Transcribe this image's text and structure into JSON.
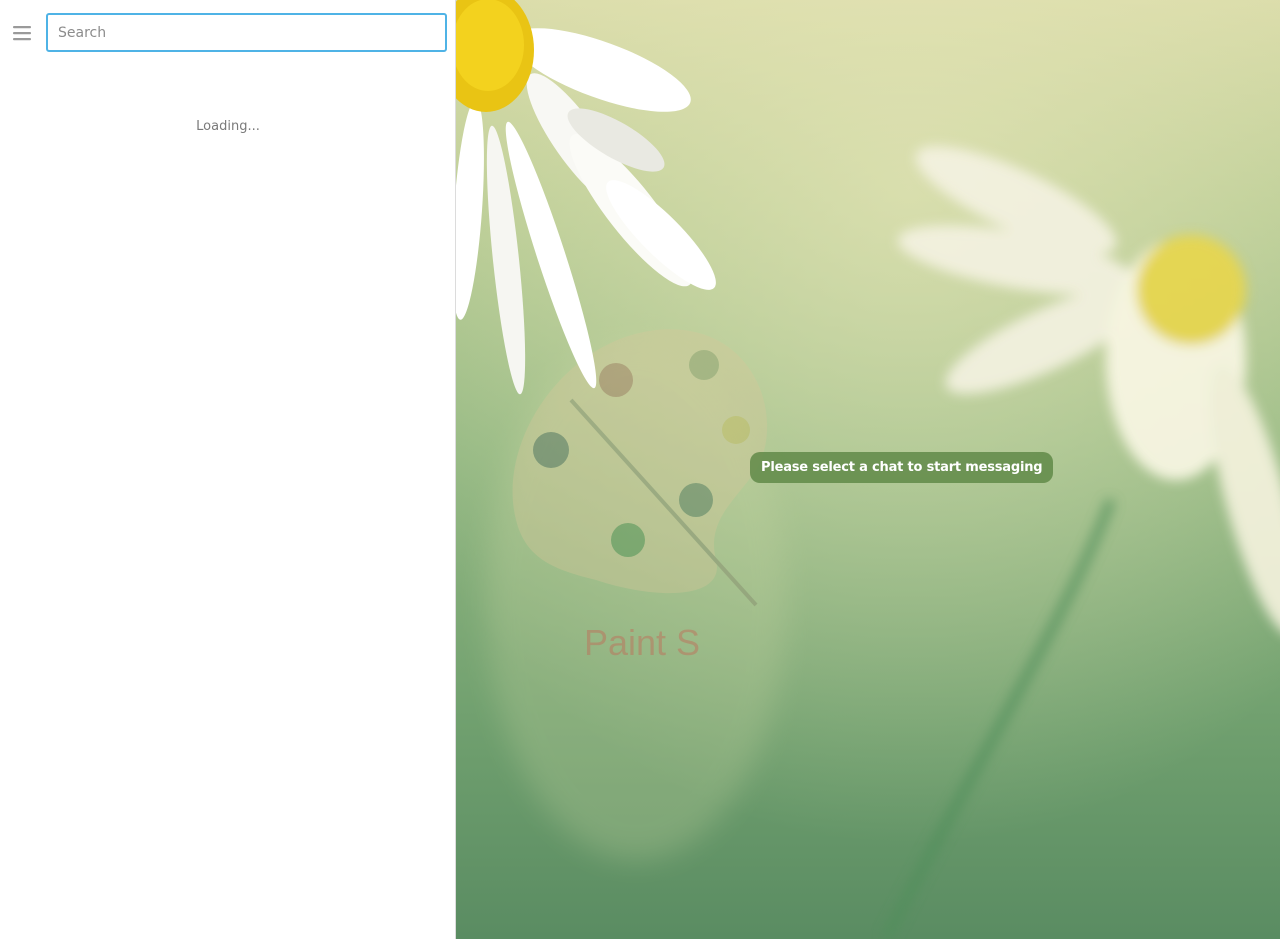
{
  "sidebar": {
    "search": {
      "placeholder": "Search",
      "value": ""
    },
    "loading_text": "Loading...",
    "menu_icon": "hamburger-menu-icon"
  },
  "main": {
    "empty_state_message": "Please select a chat to start messaging",
    "watermark_text": "Paint S"
  },
  "colors": {
    "search_focus_border": "#4fb3e6",
    "empty_state_bg": "#608a48",
    "wallpaper_top": "#d9dba8",
    "wallpaper_bottom": "#5a8c62"
  }
}
